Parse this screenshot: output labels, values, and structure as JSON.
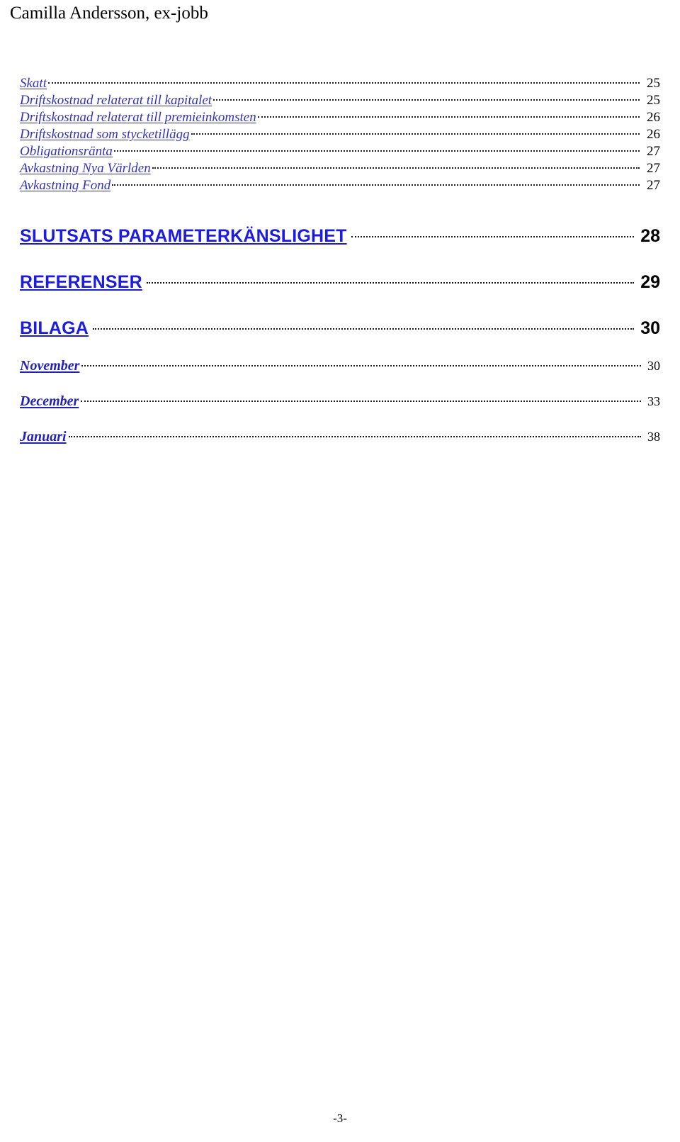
{
  "header": {
    "running_title": "Camilla Andersson, ex-jobb"
  },
  "toc": {
    "subentries_group1": [
      {
        "label": "Skatt",
        "page": "25"
      },
      {
        "label": "Driftskostnad relaterat till kapitalet",
        "page": "25"
      },
      {
        "label": "Driftskostnad relaterat till premieinkomsten",
        "page": "26"
      },
      {
        "label": "Driftskostnad som stycketillägg",
        "page": "26"
      },
      {
        "label": "Obligationsränta",
        "page": "27"
      },
      {
        "label": "Avkastning Nya Världen",
        "page": "27"
      },
      {
        "label": "Avkastning Fond",
        "page": "27"
      }
    ],
    "headings": [
      {
        "label": "SLUTSATS PARAMETERKÄNSLIGHET",
        "page": "28"
      },
      {
        "label": "REFERENSER",
        "page": "29"
      },
      {
        "label": "BILAGA",
        "page": "30"
      }
    ],
    "months": [
      {
        "label": "November",
        "page": "30"
      },
      {
        "label": "December",
        "page": "33"
      },
      {
        "label": "Januari",
        "page": "38"
      }
    ]
  },
  "footer": {
    "page_marker": "-3-"
  },
  "colors": {
    "subentry_link": "#3333bb",
    "heading_link": "#1c1ce0",
    "month_link": "#2222bb",
    "page_number": "#000000",
    "body_text": "#000000",
    "page_background": "#ffffff"
  }
}
